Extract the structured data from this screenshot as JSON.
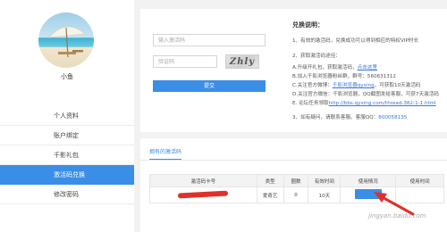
{
  "user": {
    "name": "小鱼"
  },
  "sidebar": {
    "items": [
      {
        "label": "个人资料",
        "active": false
      },
      {
        "label": "账户绑定",
        "active": false
      },
      {
        "label": "千影礼包",
        "active": false
      },
      {
        "label": "激活码兑换",
        "active": true
      },
      {
        "label": "修改密码",
        "active": false
      }
    ]
  },
  "redeem_form": {
    "code_placeholder": "输入激活码",
    "captcha_placeholder": "验证码",
    "captcha_text": "Zhly",
    "submit_label": "提交"
  },
  "instructions": {
    "title": "兑换说明：",
    "step1": "1、有效的激活码，兑换成功可以得到相应的特权VIP时长",
    "step2": "2、获取激活码途径：",
    "route_a_prefix": "A.升级开礼包，获取激活码，",
    "route_a_link": "点击这里",
    "route_b": "B.加入千影浏览器粉丝群，群号：560631312",
    "route_c_prefix": "C.关注官方微博：",
    "route_c_link": "千影浏览器qyxing",
    "route_c_suffix": "，可获取10天激活码",
    "route_d": "D.关注官方微信：千影浏览器，QQ截图发给客服，可获7天激活码",
    "route_e_prefix": "E. 论坛任务领取",
    "route_e_link": "http://bbs.qyxing.com/thread-382-1-1.html",
    "step3_prefix": "3、如有疑问，请联系客服。客服QQ：",
    "step3_qq": "800058135"
  },
  "codes_panel": {
    "tab_label": "拥有的激活码",
    "columns": [
      "激活码卡号",
      "类型",
      "圈数",
      "有效时间",
      "使用情况",
      "使用时间"
    ],
    "rows": [
      {
        "type": "爱奇艺",
        "count": "0",
        "valid": "10天"
      }
    ]
  },
  "watermark": "jingyan.baidu.com",
  "colors": {
    "accent": "#3a8ee6",
    "annotation_red": "#e0302a"
  },
  "icons": {
    "avatar": "beach-umbrella-avatar"
  }
}
